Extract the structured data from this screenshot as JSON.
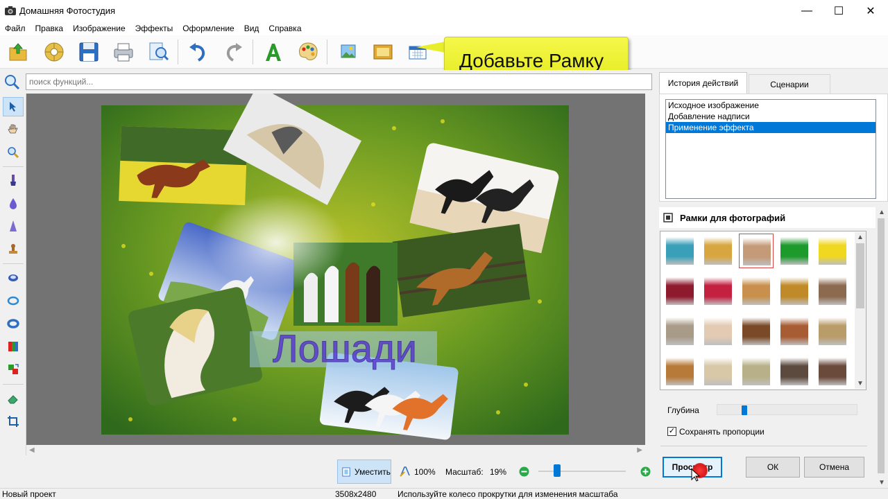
{
  "window": {
    "title": "Домашняя Фотостудия",
    "controls": {
      "minimize": "—",
      "maximize": "☐",
      "close": "✕"
    }
  },
  "menu": [
    "Файл",
    "Правка",
    "Изображение",
    "Эффекты",
    "Оформление",
    "Вид",
    "Справка"
  ],
  "toolbar": {
    "buttons": [
      "open-icon",
      "disc-icon",
      "save-icon",
      "print-icon",
      "zoom-page-icon",
      "undo-icon",
      "redo-icon",
      "text-A-icon",
      "palette-icon",
      "image-effects-icon",
      "frame-icon",
      "calendar-icon"
    ]
  },
  "tooltip": {
    "text": "Добавьте Рамку"
  },
  "search": {
    "placeholder": "поиск функций..."
  },
  "canvas": {
    "caption": "Лошади"
  },
  "bottom": {
    "fit_label": "Уместить",
    "zoom_100": "100%",
    "scale_label": "Масштаб:",
    "scale_value": "19%",
    "zoom_level": 0.19
  },
  "status": {
    "project": "Новый проект",
    "dimensions": "3508x2480",
    "hint": "Используйте колесо прокрутки для изменения масштаба"
  },
  "panel": {
    "tabs": [
      {
        "label": "История действий",
        "active": true
      },
      {
        "label": "Сценарии",
        "active": false
      }
    ],
    "history": [
      {
        "label": "Исходное изображение",
        "selected": false
      },
      {
        "label": "Добавление надписи",
        "selected": false
      },
      {
        "label": "Применение эффекта",
        "selected": true
      }
    ],
    "frames_title": "Рамки для фотографий",
    "frames": [
      [
        "#3a9fb8",
        "#d8a640",
        "#c49a78",
        "#1c9a2c",
        "#f0d820"
      ],
      [
        "#8e1a2e",
        "#c42040",
        "#c8904c",
        "#c08a28",
        "#8c6a50"
      ],
      [
        "#a89c88",
        "#e2cbb2",
        "#7a4a28",
        "#a85c34",
        "#b89c6a"
      ],
      [
        "#b87a38",
        "#d8c8a8",
        "#b8b088",
        "#5c4a3e",
        "#6a4a3a"
      ]
    ],
    "selected_frame": {
      "row": 0,
      "col": 2
    },
    "depth_label": "Глубина",
    "depth_value": 0.18,
    "keep_proportions_label": "Сохранять пропорции",
    "keep_proportions": true,
    "buttons": {
      "preview": "Просмотр",
      "ok": "ОК",
      "cancel": "Отмена"
    }
  }
}
